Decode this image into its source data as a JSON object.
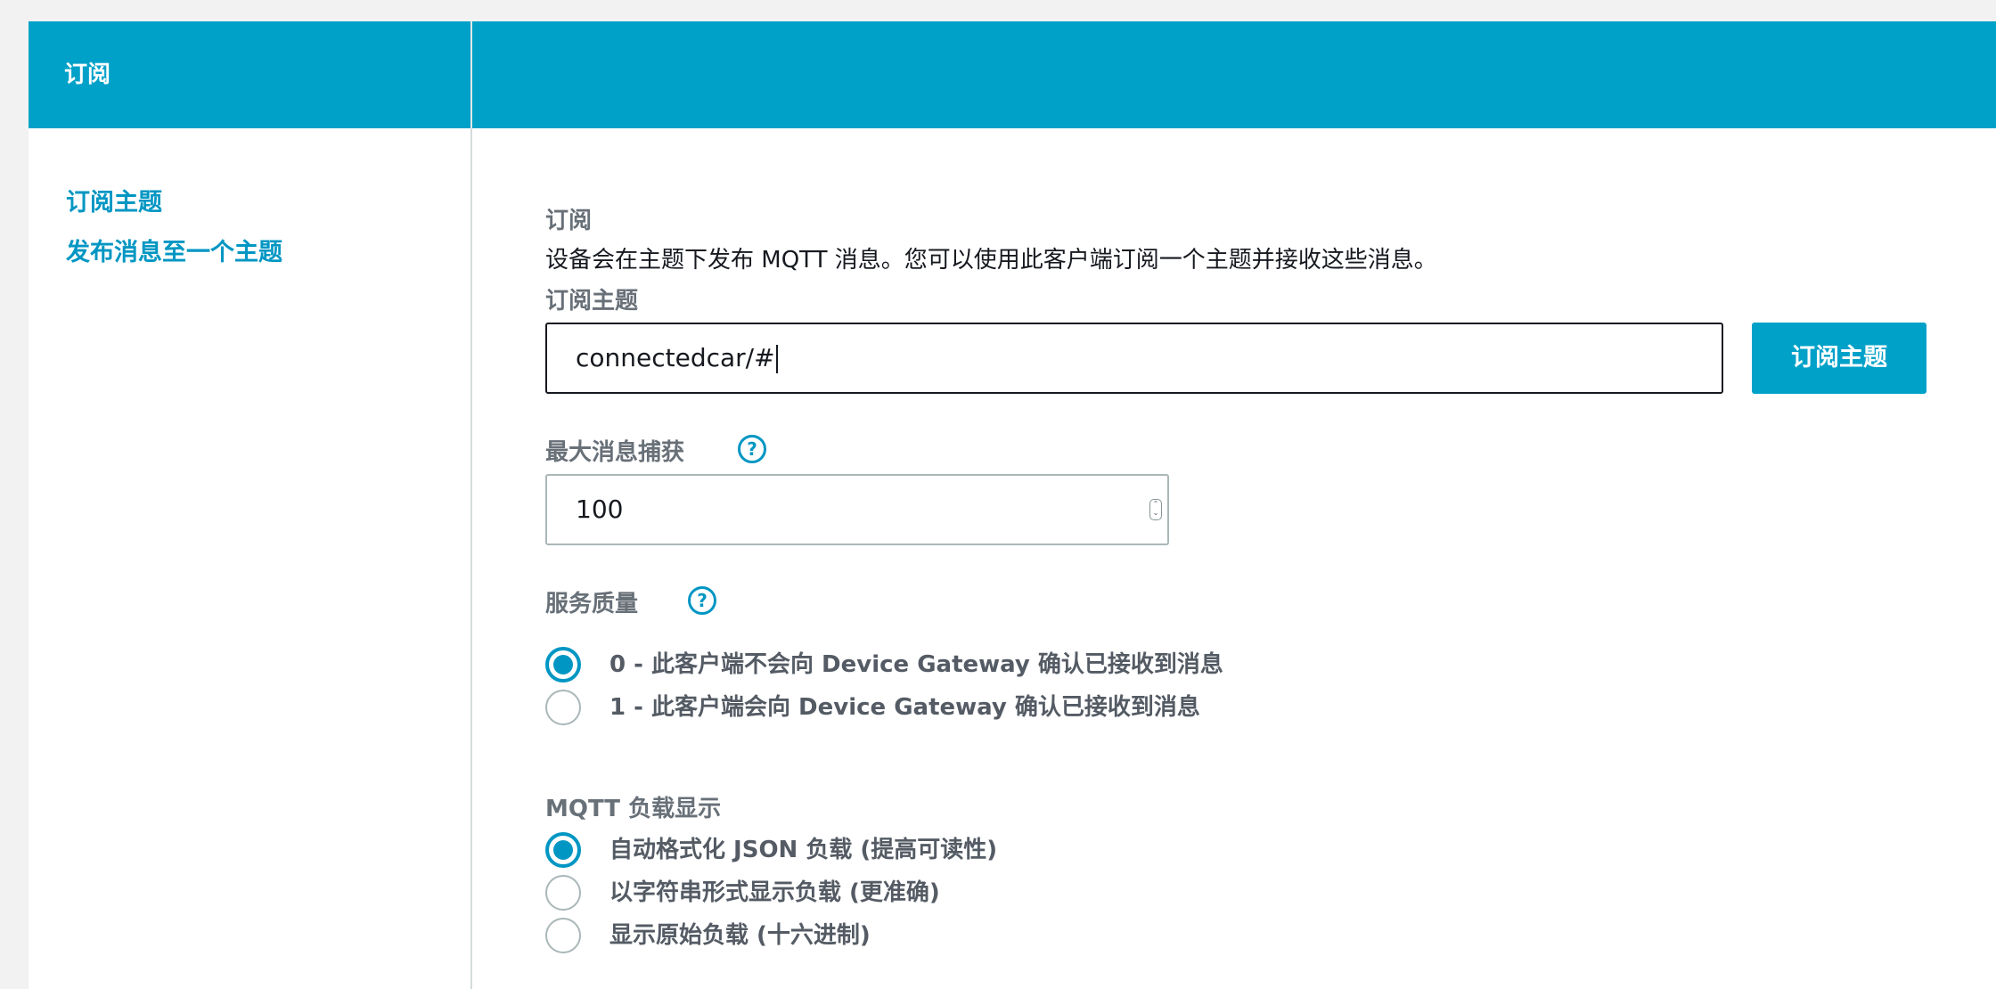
{
  "header": {
    "title": "订阅"
  },
  "sidebar": {
    "items": [
      {
        "label": "订阅主题"
      },
      {
        "label": "发布消息至一个主题"
      }
    ]
  },
  "main": {
    "section_title": "订阅",
    "description": "设备会在主题下发布 MQTT 消息。您可以使用此客户端订阅一个主题并接收这些消息。",
    "topic_label": "订阅主题",
    "topic_value": "connectedcar/#",
    "subscribe_button": "订阅主题",
    "max_capture_label": "最大消息捕获",
    "max_capture_value": "100",
    "help_glyph": "?",
    "qos_label": "服务质量",
    "qos_options": [
      {
        "label": "0 - 此客户端不会向 Device Gateway 确认已接收到消息",
        "selected": true
      },
      {
        "label": "1 - 此客户端会向 Device Gateway 确认已接收到消息",
        "selected": false
      }
    ],
    "payload_label": "MQTT 负载显示",
    "payload_options": [
      {
        "label": "自动格式化 JSON 负载 (提高可读性)",
        "selected": true
      },
      {
        "label": "以字符串形式显示负载 (更准确)",
        "selected": false
      },
      {
        "label": "显示原始负载 (十六进制)",
        "selected": false
      }
    ]
  },
  "colors": {
    "accent": "#00a1c9",
    "link": "#0096c3",
    "label": "#687078",
    "text": "#16191f"
  },
  "icons": {
    "help": "help-circle-icon",
    "stepper": "number-stepper-icon"
  }
}
